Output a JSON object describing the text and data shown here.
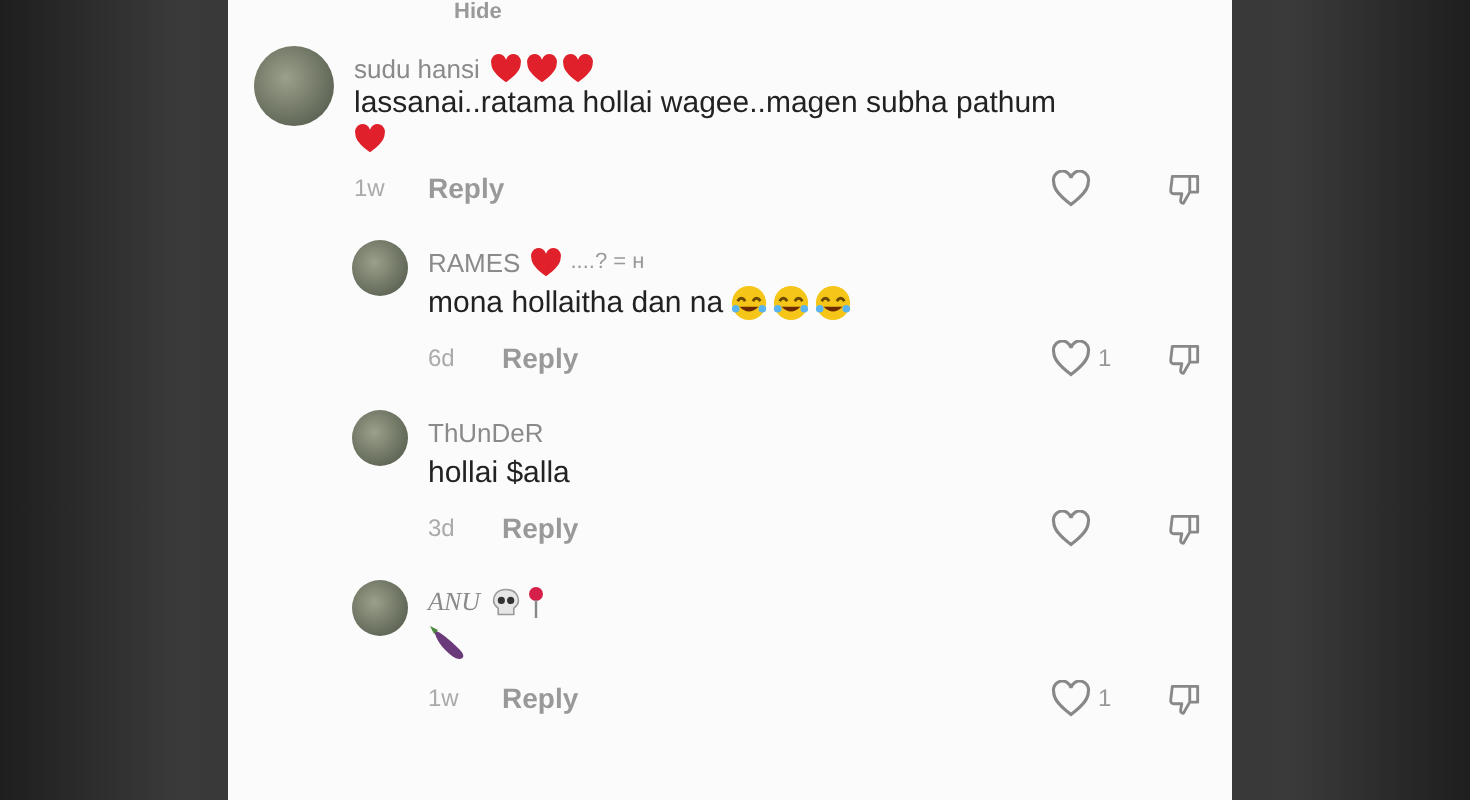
{
  "hide_link": {
    "label": "Hide"
  },
  "comments": [
    {
      "name": "sudu hansi",
      "name_emojis": [
        {
          "kind": "heart"
        },
        {
          "kind": "heart"
        },
        {
          "kind": "heart"
        }
      ],
      "text": "lassanai..ratama hollai wagee..magen subha pathum",
      "text_emojis": [
        {
          "kind": "heart"
        }
      ],
      "emoji_break": true,
      "time": "1w",
      "reply": "Reply",
      "is_reply": false,
      "italic_name": false
    },
    {
      "name": "RAMES",
      "name_emojis": [
        {
          "kind": "heart"
        }
      ],
      "name_suffix": "....? = н",
      "text": "mona hollaitha dan na",
      "text_emojis": [
        {
          "kind": "laugh"
        },
        {
          "kind": "laugh"
        },
        {
          "kind": "laugh"
        }
      ],
      "emoji_break": false,
      "time": "6d",
      "reply": "Reply",
      "likes": "1",
      "is_reply": true,
      "italic_name": false
    },
    {
      "name": "ThUnDeR",
      "text": "hollai $alla",
      "emoji_break": false,
      "time": "3d",
      "reply": "Reply",
      "is_reply": true,
      "italic_name": false
    },
    {
      "name": "ANU",
      "name_emojis": [
        {
          "kind": "skull"
        },
        {
          "kind": "pin"
        }
      ],
      "text_emojis": [
        {
          "kind": "eggplant"
        }
      ],
      "emoji_break": false,
      "time": "1w",
      "reply": "Reply",
      "likes": "1",
      "is_reply": true,
      "italic_name": true
    }
  ]
}
